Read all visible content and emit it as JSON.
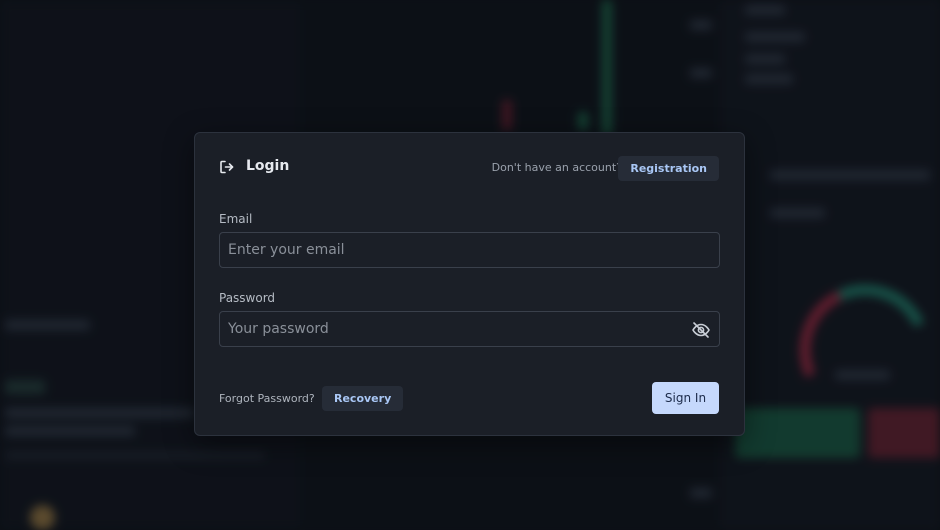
{
  "modal": {
    "title": "Login",
    "header_prompt": "Don't have an account?",
    "registration_label": "Registration",
    "email": {
      "label": "Email",
      "placeholder": "Enter your email",
      "value": ""
    },
    "password": {
      "label": "Password",
      "placeholder": "Your password",
      "value": "",
      "visibility_icon": "eye-off-icon"
    },
    "forgot_prompt": "Forgot Password?",
    "recovery_label": "Recovery",
    "signin_label": "Sign In",
    "login_icon": "login-arrow-icon"
  },
  "colors": {
    "modal_bg": "#1b1f27",
    "accent_button_bg": "#c5d8fc",
    "link_text": "#a9c7f5",
    "secondary_button_bg": "#262c37"
  }
}
